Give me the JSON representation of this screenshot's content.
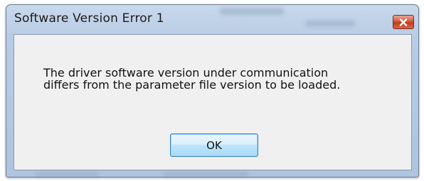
{
  "dialog": {
    "title": "Software Version Error 1",
    "message_line1": "The driver software version under communication",
    "message_line2": "differs from the parameter file version to be loaded.",
    "ok_label": "OK",
    "close_icon": "close-icon"
  },
  "colors": {
    "frame": "#b8cce4",
    "client_bg": "#f0f0f0",
    "close_red": "#c03a1c",
    "button_blue": "#bee6fd"
  }
}
